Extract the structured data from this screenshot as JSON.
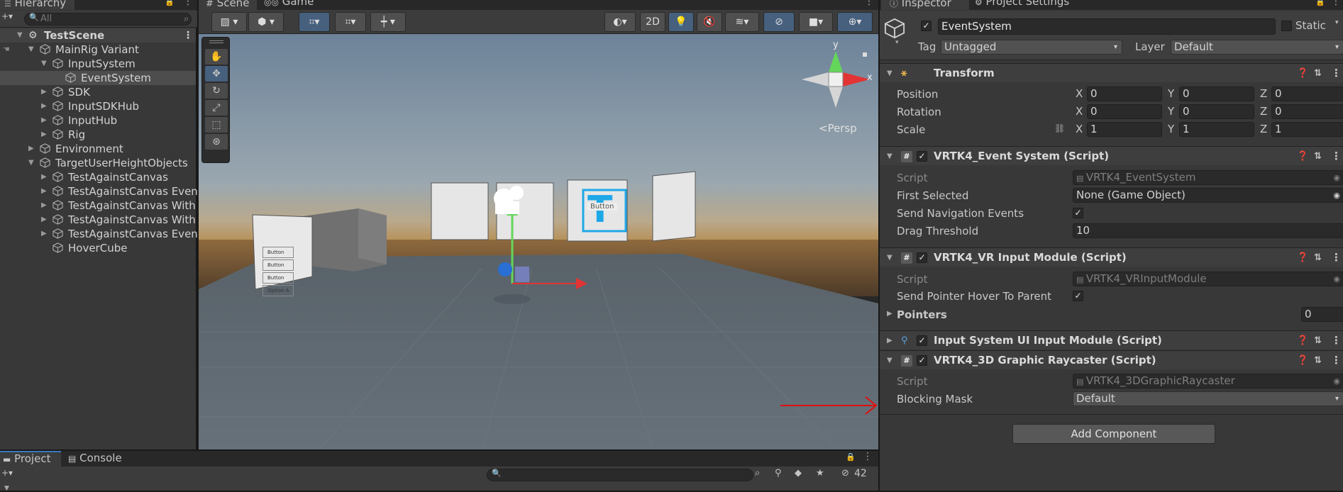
{
  "hierarchy": {
    "tab": "Hierarchy",
    "search_placeholder": "All",
    "scene": "TestScene",
    "items": [
      {
        "label": "MainRig Variant"
      },
      {
        "label": "InputSystem"
      },
      {
        "label": "EventSystem"
      },
      {
        "label": "SDK"
      },
      {
        "label": "InputSDKHub"
      },
      {
        "label": "InputHub"
      },
      {
        "label": "Rig"
      },
      {
        "label": "Environment"
      },
      {
        "label": "TargetUserHeightObjects"
      },
      {
        "label": "TestAgainstCanvas"
      },
      {
        "label": "TestAgainstCanvas Even"
      },
      {
        "label": "TestAgainstCanvas With"
      },
      {
        "label": "TestAgainstCanvas With"
      },
      {
        "label": "TestAgainstCanvas Even"
      },
      {
        "label": "HoverCube"
      }
    ]
  },
  "scene_view": {
    "tab_scene": "Scene",
    "tab_game": "Game",
    "btn_2d": "2D",
    "persp_label": "<Persp",
    "gizmo_y": "y",
    "gizmo_x": "x",
    "panel_buttons": [
      "Button",
      "Button",
      "Button",
      "Option A"
    ],
    "text_t": "T",
    "text_button": "Button"
  },
  "inspector": {
    "tab_inspector": "Inspector",
    "tab_project_settings": "Project Settings",
    "object_name": "EventSystem",
    "static_label": "Static",
    "tag_label": "Tag",
    "tag_value": "Untagged",
    "layer_label": "Layer",
    "layer_value": "Default",
    "transform": {
      "title": "Transform",
      "position_label": "Position",
      "rotation_label": "Rotation",
      "scale_label": "Scale",
      "x": "X",
      "y": "Y",
      "z": "Z",
      "position": [
        "0",
        "0",
        "0"
      ],
      "rotation": [
        "0",
        "0",
        "0"
      ],
      "scale": [
        "1",
        "1",
        "1"
      ]
    },
    "event_system": {
      "title": "VRTK4_Event System (Script)",
      "script_label": "Script",
      "script_value": "VRTK4_EventSystem",
      "first_selected_label": "First Selected",
      "first_selected_value": "None (Game Object)",
      "send_nav_label": "Send Navigation Events",
      "drag_label": "Drag Threshold",
      "drag_value": "10"
    },
    "vr_input": {
      "title": "VRTK4_VR Input Module (Script)",
      "script_label": "Script",
      "script_value": "VRTK4_VRInputModule",
      "hover_label": "Send Pointer Hover To Parent",
      "pointers_label": "Pointers",
      "pointers_value": "0"
    },
    "ui_input": {
      "title": "Input System UI Input Module (Script)"
    },
    "raycaster": {
      "title": "VRTK4_3D Graphic Raycaster (Script)",
      "script_label": "Script",
      "script_value": "VRTK4_3DGraphicRaycaster",
      "mask_label": "Blocking Mask",
      "mask_value": "Default"
    },
    "add_component": "Add Component"
  },
  "project": {
    "tab_project": "Project",
    "tab_console": "Console",
    "count": "42"
  },
  "colors": {
    "accent": "#3a79bb",
    "annotation_arrow": "#e01010",
    "sky_top": "#7b8ea3",
    "ground": "#5a646c",
    "horizon": "#a07a4a"
  }
}
